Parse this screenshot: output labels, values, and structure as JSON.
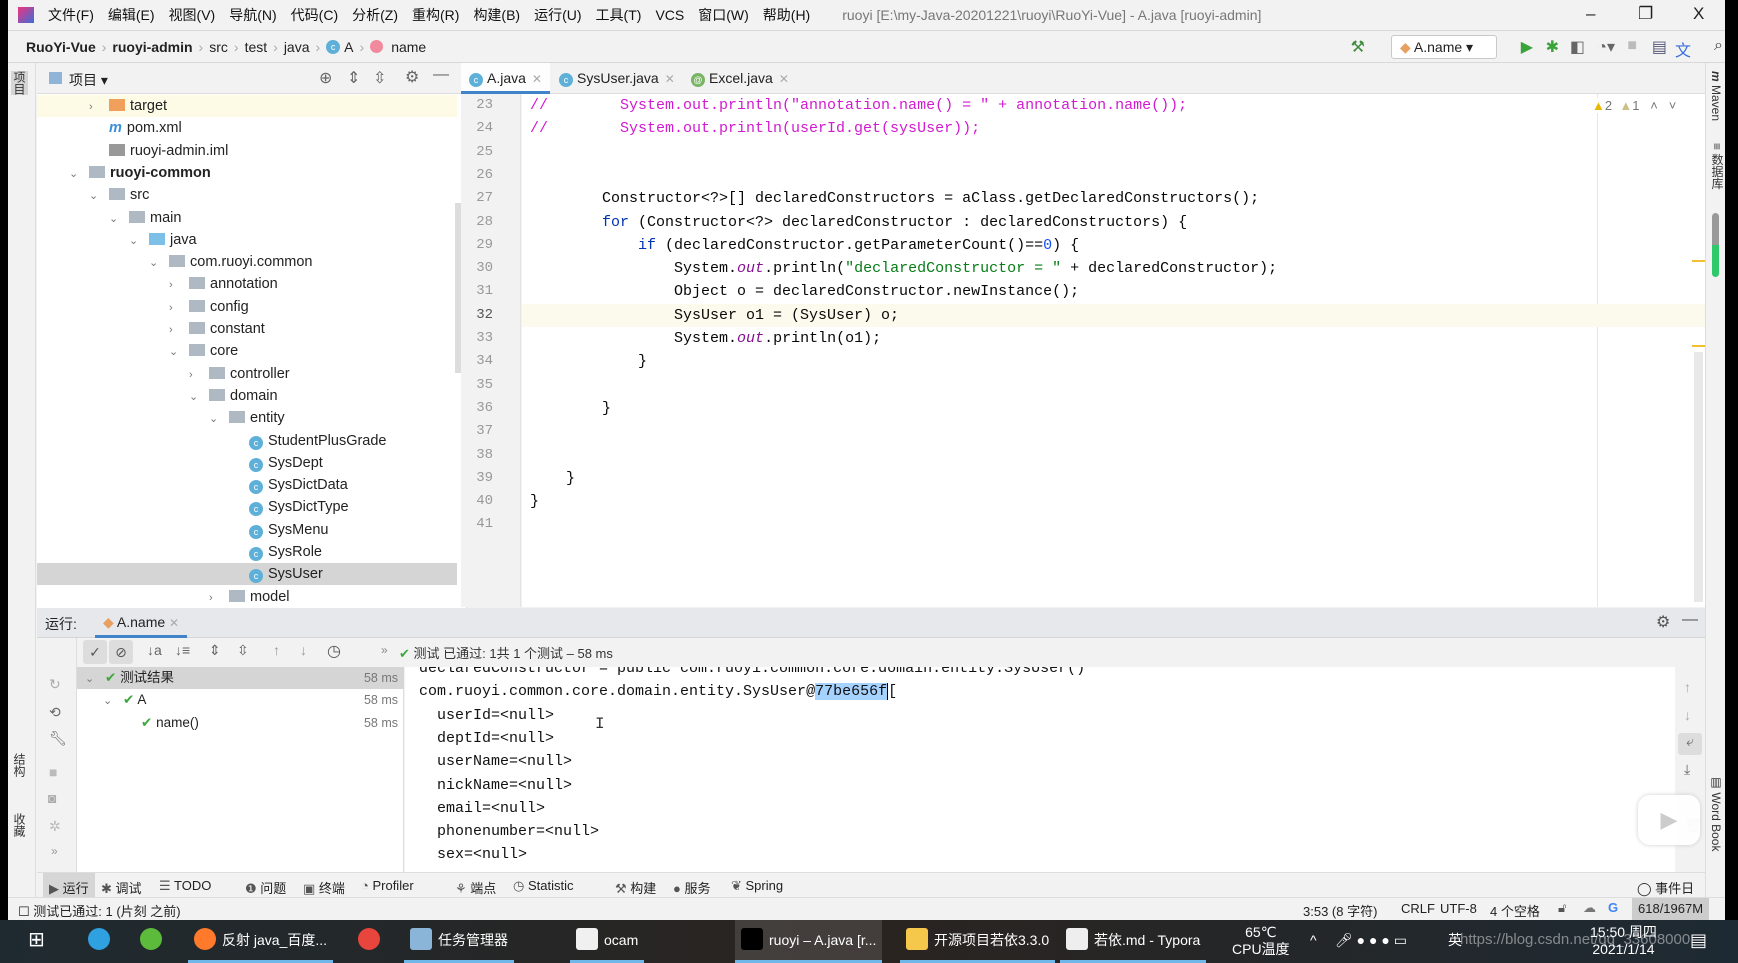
{
  "titlebar": {
    "menu": [
      "文件(F)",
      "编辑(E)",
      "视图(V)",
      "导航(N)",
      "代码(C)",
      "分析(Z)",
      "重构(R)",
      "构建(B)",
      "运行(U)",
      "工具(T)",
      "VCS",
      "窗口(W)",
      "帮助(H)"
    ],
    "title": "ruoyi [E:\\my-Java-20201221\\ruoyi\\RuoYi-Vue] - A.java [ruoyi-admin]",
    "minimize": "–",
    "restore": "❐",
    "close": "X"
  },
  "breadcrumb": {
    "items": [
      "RuoYi-Vue",
      "ruoyi-admin",
      "src",
      "test",
      "java",
      "A",
      "name"
    ],
    "run_config": "A.name"
  },
  "project": {
    "title": "项目",
    "tree": [
      {
        "label": "target",
        "depth": 1,
        "arrow": "right",
        "icon": "folder-orange"
      },
      {
        "label": "pom.xml",
        "depth": 1,
        "arrow": "",
        "icon": "maven"
      },
      {
        "label": "ruoyi-admin.iml",
        "depth": 1,
        "arrow": "",
        "icon": "file"
      },
      {
        "label": "ruoyi-common",
        "depth": 0,
        "arrow": "down",
        "icon": "module",
        "bold": true
      },
      {
        "label": "src",
        "depth": 1,
        "arrow": "down",
        "icon": "folder"
      },
      {
        "label": "main",
        "depth": 2,
        "arrow": "down",
        "icon": "folder"
      },
      {
        "label": "java",
        "depth": 3,
        "arrow": "down",
        "icon": "folder-blue"
      },
      {
        "label": "com.ruoyi.common",
        "depth": 4,
        "arrow": "down",
        "icon": "package"
      },
      {
        "label": "annotation",
        "depth": 5,
        "arrow": "right",
        "icon": "package"
      },
      {
        "label": "config",
        "depth": 5,
        "arrow": "right",
        "icon": "package"
      },
      {
        "label": "constant",
        "depth": 5,
        "arrow": "right",
        "icon": "package"
      },
      {
        "label": "core",
        "depth": 5,
        "arrow": "down",
        "icon": "package"
      },
      {
        "label": "controller",
        "depth": 6,
        "arrow": "right",
        "icon": "package"
      },
      {
        "label": "domain",
        "depth": 6,
        "arrow": "down",
        "icon": "package"
      },
      {
        "label": "entity",
        "depth": 7,
        "arrow": "down",
        "icon": "package"
      },
      {
        "label": "StudentPlusGrade",
        "depth": 8,
        "arrow": "",
        "icon": "class"
      },
      {
        "label": "SysDept",
        "depth": 8,
        "arrow": "",
        "icon": "class"
      },
      {
        "label": "SysDictData",
        "depth": 8,
        "arrow": "",
        "icon": "class"
      },
      {
        "label": "SysDictType",
        "depth": 8,
        "arrow": "",
        "icon": "class"
      },
      {
        "label": "SysMenu",
        "depth": 8,
        "arrow": "",
        "icon": "class"
      },
      {
        "label": "SysRole",
        "depth": 8,
        "arrow": "",
        "icon": "class"
      },
      {
        "label": "SysUser",
        "depth": 8,
        "arrow": "",
        "icon": "class",
        "selected": true
      },
      {
        "label": "model",
        "depth": 7,
        "arrow": "right",
        "icon": "package"
      }
    ]
  },
  "editor": {
    "tabs": [
      {
        "label": "A.java",
        "active": true
      },
      {
        "label": "SysUser.java"
      },
      {
        "label": "Excel.java"
      }
    ],
    "warnings": "2",
    "weak_warnings": "1",
    "current_line": 32,
    "lines": [
      {
        "n": 23,
        "seg": [
          [
            "comment",
            "//        System.out.println(\"annotation.name() = \" + annotation.name());"
          ]
        ]
      },
      {
        "n": 24,
        "seg": [
          [
            "comment",
            "//        System.out.println(userId.get(sysUser));"
          ]
        ]
      },
      {
        "n": 25,
        "seg": []
      },
      {
        "n": 26,
        "seg": []
      },
      {
        "n": 27,
        "seg": [
          [
            "plain",
            "        Constructor<?>[] declaredConstructors = aClass.getDeclaredConstructors();"
          ]
        ]
      },
      {
        "n": 28,
        "seg": [
          [
            "kw",
            "        for"
          ],
          [
            "plain",
            " (Constructor<?> declaredConstructor : declaredConstructors) {"
          ]
        ]
      },
      {
        "n": 29,
        "seg": [
          [
            "kw",
            "            if"
          ],
          [
            "plain",
            " (declaredConstructor.getParameterCount()=="
          ],
          [
            "num",
            "0"
          ],
          [
            "plain",
            ") {"
          ]
        ]
      },
      {
        "n": 30,
        "seg": [
          [
            "plain",
            "                System."
          ],
          [
            "field",
            "out"
          ],
          [
            "plain",
            ".println("
          ],
          [
            "str",
            "\"declaredConstructor = \""
          ],
          [
            "plain",
            " + declaredConstructor);"
          ]
        ]
      },
      {
        "n": 31,
        "seg": [
          [
            "plain",
            "                Object o = declaredConstructor.newInstance();"
          ]
        ]
      },
      {
        "n": 32,
        "seg": [
          [
            "plain",
            "                SysUser o1 = (SysUser) o;"
          ]
        ]
      },
      {
        "n": 33,
        "seg": [
          [
            "plain",
            "                System."
          ],
          [
            "field",
            "out"
          ],
          [
            "plain",
            ".println(o1);"
          ]
        ]
      },
      {
        "n": 34,
        "seg": [
          [
            "plain",
            "            }"
          ]
        ]
      },
      {
        "n": 35,
        "seg": []
      },
      {
        "n": 36,
        "seg": [
          [
            "plain",
            "        }"
          ]
        ]
      },
      {
        "n": 37,
        "seg": []
      },
      {
        "n": 38,
        "seg": []
      },
      {
        "n": 39,
        "seg": [
          [
            "plain",
            "    }"
          ]
        ]
      },
      {
        "n": 40,
        "seg": [
          [
            "plain",
            "}"
          ]
        ]
      },
      {
        "n": 41,
        "seg": []
      }
    ]
  },
  "right_strip": {
    "maven": "Maven",
    "database": "数据库",
    "wordbook": "Word Book"
  },
  "left_strip": {
    "project": "项目",
    "structure": "结构",
    "favorites": "收藏"
  },
  "run": {
    "label": "运行:",
    "tab": "A.name",
    "status": "测试 已通过: 1共 1 个测试 – 58 ms",
    "tests": [
      {
        "label": "测试结果",
        "time": "58 ms",
        "depth": 0
      },
      {
        "label": "A",
        "time": "58 ms",
        "depth": 1
      },
      {
        "label": "name()",
        "time": "58 ms",
        "depth": 2
      }
    ],
    "console": [
      "declaredConstructor = public com.ruoyi.common.core.domain.entity.SysUser()",
      "com.ruoyi.common.core.domain.entity.SysUser@",
      "  userId=<null>",
      "  deptId=<null>",
      "  userName=<null>",
      "  nickName=<null>",
      "  email=<null>",
      "  phonenumber=<null>",
      "  sex=<null>"
    ],
    "selected_hash": "77be656f",
    "after_hash": "["
  },
  "toolwindows": [
    "运行",
    "调试",
    "TODO",
    "问题",
    "终端",
    "Profiler",
    "端点",
    "Statistic",
    "构建",
    "服务",
    "Spring"
  ],
  "event_log": "事件日志",
  "status": {
    "message": "测试已通过: 1 (片刻 之前)",
    "position": "3:53 (8 字符)",
    "line_sep": "CRLF",
    "encoding": "UTF-8",
    "indent": "4 个空格",
    "memory": "618/1967M"
  },
  "taskbar": {
    "apps": [
      {
        "label": "",
        "icon": "edge"
      },
      {
        "label": "",
        "icon": "ie-green"
      },
      {
        "label": "反射 java_百度...",
        "icon": "firefox"
      },
      {
        "label": "",
        "icon": "chrome"
      },
      {
        "label": "任务管理器",
        "icon": "task-manager"
      },
      {
        "label": "ocam",
        "icon": "ocam"
      },
      {
        "label": "ruoyi – A.java [r...",
        "icon": "intellij"
      },
      {
        "label": "开源项目若依3.3.0",
        "icon": "folder"
      },
      {
        "label": "若依.md - Typora",
        "icon": "typora"
      }
    ],
    "temp": "65℃",
    "temp_label": "CPU温度",
    "ime": "英",
    "time": "15:50 周四",
    "date": "2021/1/14",
    "watermark": "https://blog.csdn.net/qq_33608000"
  },
  "colors": {
    "accent": "#4083c9",
    "comment": "#d11ad1",
    "keyword": "#0033b3",
    "string": "#067d17",
    "pass": "#3ea63e"
  }
}
